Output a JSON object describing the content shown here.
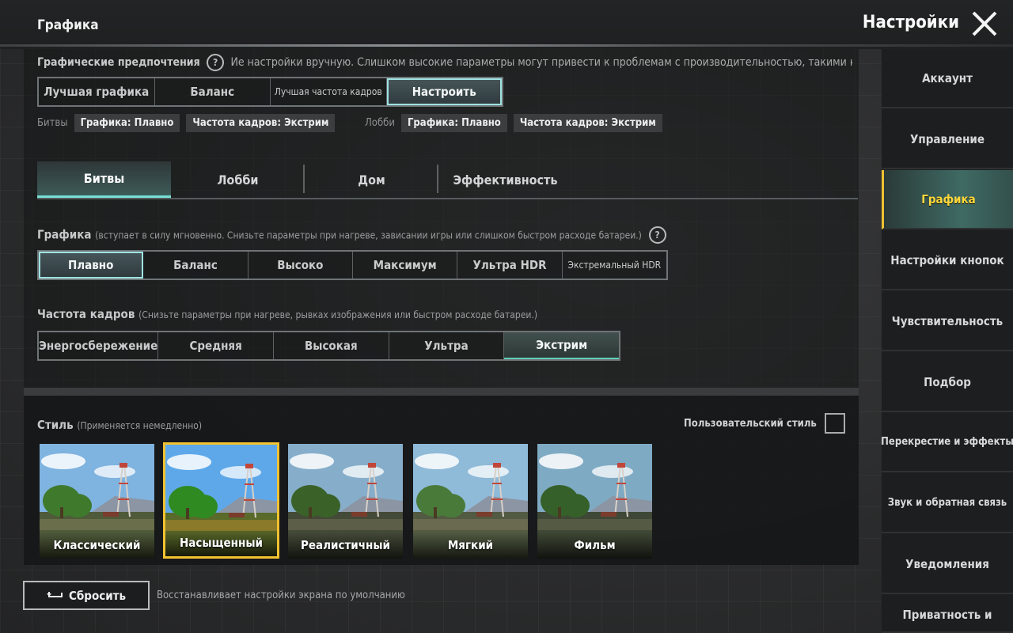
{
  "header": {
    "section_title": "Графика",
    "settings_title": "Настройки",
    "close_icon": "close-icon"
  },
  "preferences": {
    "title": "Графические предпочтения",
    "hint": "Ие настройки вручную. Слишком высокие параметры могут привести к проблемам с производительностью, такими как перегр",
    "options": [
      "Лучшая графика",
      "Баланс",
      "Лучшая частота кадров",
      "Настроить"
    ],
    "selected": "Настроить",
    "battles_label": "Битвы",
    "battles_graphics": "Графика: Плавно",
    "battles_fps": "Частота кадров: Экстрим",
    "lobby_label": "Лобби",
    "lobby_graphics": "Графика: Плавно",
    "lobby_fps": "Частота кадров: Экстрим"
  },
  "tabs": [
    "Битвы",
    "Лобби",
    "Дом",
    "Эффективность"
  ],
  "active_tab": "Битвы",
  "graphics": {
    "label": "Графика",
    "hint": "(вступает в силу мгновенно. Снизьте параметры при нагреве, зависании игры или слишком быстром расходе батареи.)",
    "options": [
      "Плавно",
      "Баланс",
      "Высоко",
      "Максимум",
      "Ультра HDR",
      "Экстремальный HDR"
    ],
    "selected": "Плавно"
  },
  "fps": {
    "label": "Частота кадров",
    "hint": "(Снизьте параметры при нагреве, рывках изображения или быстром расходе батареи.)",
    "options": [
      "Энергосбережение",
      "Средняя",
      "Высокая",
      "Ультра",
      "Экстрим"
    ],
    "selected": "Экстрим"
  },
  "style": {
    "label": "Стиль",
    "hint": "(Применяется немедленно)",
    "custom_label": "Пользовательский стиль",
    "options": [
      "Классический",
      "Насыщенный",
      "Реалистичный",
      "Мягкий",
      "Фильм"
    ],
    "selected": "Насыщенный"
  },
  "reset": {
    "label": "Сбросить",
    "hint": "Восстанавливает настройки экрана по умолчанию"
  },
  "sidebar": {
    "items": [
      "Аккаунт",
      "Управление",
      "Графика",
      "Настройки кнопок",
      "Чувствительность",
      "Подбор",
      "Перекрестие и эффекты",
      "Звук и обратная связь",
      "Уведомления",
      "Приватность и"
    ],
    "active": "Графика"
  },
  "colors": {
    "accent": "#9fe3e3",
    "selected_style": "#f2c230",
    "sidebar_active_text": "#ffd83a"
  }
}
